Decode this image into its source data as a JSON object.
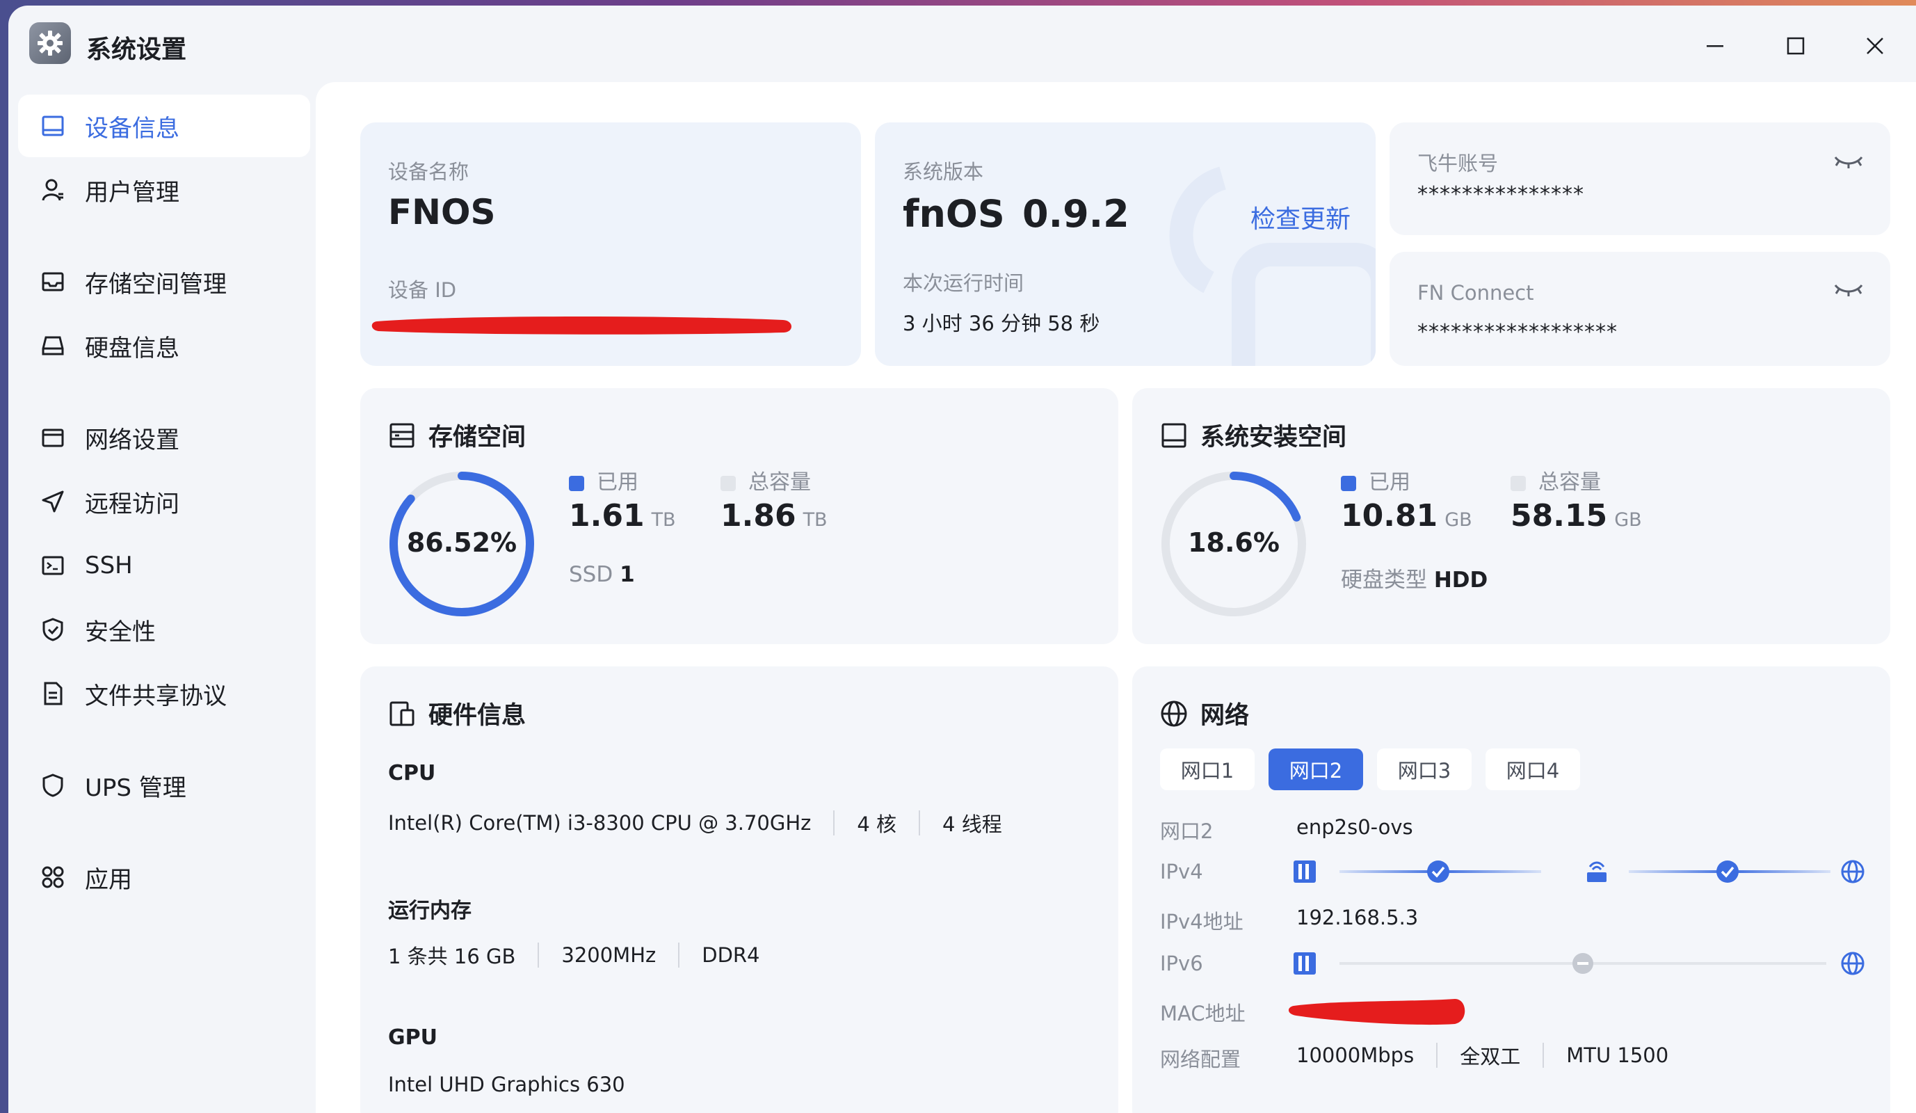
{
  "window": {
    "title": "系统设置",
    "minimize": "—",
    "maximize": "☐",
    "close": "✕"
  },
  "sidebar": {
    "items": [
      {
        "label": "设备信息",
        "icon": "monitor-icon",
        "active": true
      },
      {
        "label": "用户管理",
        "icon": "user-icon"
      },
      {
        "label": "存储空间管理",
        "icon": "storage-icon"
      },
      {
        "label": "硬盘信息",
        "icon": "disk-icon"
      },
      {
        "label": "网络设置",
        "icon": "network-card-icon"
      },
      {
        "label": "远程访问",
        "icon": "send-icon"
      },
      {
        "label": "SSH",
        "icon": "terminal-icon"
      },
      {
        "label": "安全性",
        "icon": "shield-check-icon"
      },
      {
        "label": "文件共享协议",
        "icon": "document-icon"
      },
      {
        "label": "UPS 管理",
        "icon": "shield-icon"
      },
      {
        "label": "应用",
        "icon": "apps-grid-icon"
      }
    ]
  },
  "device": {
    "name_label": "设备名称",
    "name": "FNOS",
    "id_label": "设备 ID"
  },
  "version": {
    "label": "系统版本",
    "os": "fnOS",
    "number": "0.9.2",
    "check_update": "检查更新",
    "uptime_label": "本次运行时间",
    "uptime": "3 小时 36 分钟 58 秒"
  },
  "account": {
    "label": "飞牛账号",
    "value": "***************"
  },
  "fn_connect": {
    "label": "FN Connect",
    "value": "******************"
  },
  "storage": {
    "title": "存储空间",
    "percent_text": "86.52%",
    "percent": 86.52,
    "used_label": "已用",
    "used": "1.61",
    "used_unit": "TB",
    "total_label": "总容量",
    "total": "1.86",
    "total_unit": "TB",
    "ssd_label": "SSD",
    "ssd_count": "1"
  },
  "system_space": {
    "title": "系统安装空间",
    "percent_text": "18.6%",
    "percent": 18.6,
    "used_label": "已用",
    "used": "10.81",
    "used_unit": "GB",
    "total_label": "总容量",
    "total": "58.15",
    "total_unit": "GB",
    "disk_type_label": "硬盘类型",
    "disk_type": "HDD"
  },
  "hardware": {
    "title": "硬件信息",
    "cpu_label": "CPU",
    "cpu_model": "Intel(R) Core(TM) i3-8300 CPU @ 3.70GHz",
    "cpu_cores": "4 核",
    "cpu_threads": "4 线程",
    "mem_label": "运行内存",
    "mem_size": "1 条共 16 GB",
    "mem_speed": "3200MHz",
    "mem_type": "DDR4",
    "gpu_label": "GPU",
    "gpu_model": "Intel UHD Graphics 630"
  },
  "network": {
    "title": "网络",
    "tabs": [
      "网口1",
      "网口2",
      "网口3",
      "网口4"
    ],
    "active_tab": 1,
    "port_label": "网口2",
    "port_value": "enp2s0-ovs",
    "ipv4_label": "IPv4",
    "ipv4_addr_label": "IPv4地址",
    "ipv4_addr": "192.168.5.3",
    "ipv6_label": "IPv6",
    "mac_label": "MAC地址",
    "config_label": "网络配置",
    "speed": "10000Mbps",
    "duplex": "全双工",
    "mtu": "MTU 1500"
  },
  "colors": {
    "accent": "#3b6ce0",
    "track": "#e2e5ea",
    "redaction": "#e51d1d"
  }
}
